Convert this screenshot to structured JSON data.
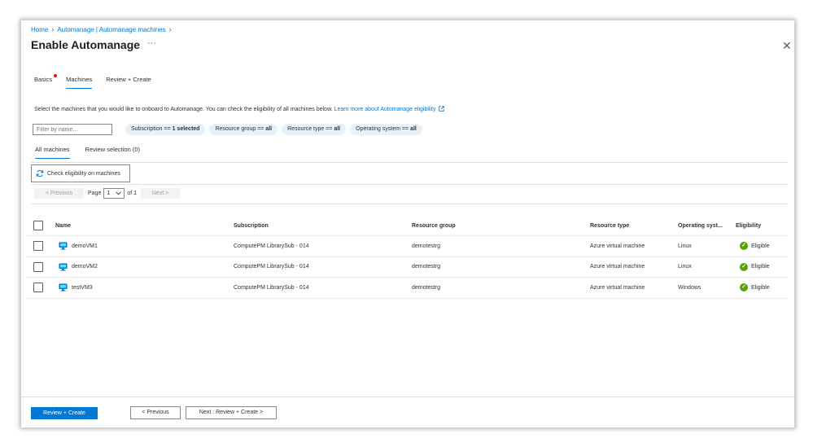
{
  "breadcrumb": [
    "Home",
    "Automanage | Automanage machines"
  ],
  "title": "Enable Automanage",
  "more_label": "···",
  "close_label": "✕",
  "wizard_tabs": [
    {
      "label": "Basics",
      "has_error": true
    },
    {
      "label": "Machines",
      "active": true
    },
    {
      "label": "Review + Create"
    }
  ],
  "description": "Select the machines that you would like to onboard to Automanage. You can check the eligibility of all machines below.",
  "learn_more_label": "Learn more about Automanage eligibility",
  "filter": {
    "placeholder": "Filter by name..."
  },
  "pills": [
    {
      "key": "Subscription == ",
      "value": "1 selected"
    },
    {
      "key": "Resource group == ",
      "value": "all"
    },
    {
      "key": "Resource type == ",
      "value": "all"
    },
    {
      "key": "Operating system == ",
      "value": "all"
    }
  ],
  "sub_tabs": [
    {
      "label": "All machines",
      "active": true
    },
    {
      "label": "Review selection (0)"
    }
  ],
  "check_eligibility_label": "Check eligibility on machines",
  "pager": {
    "prev_label": "< Previous",
    "page_label": "Page",
    "page_value": "1",
    "of_label": "of 1",
    "next_label": "Next >"
  },
  "table": {
    "columns": [
      "Name",
      "Subscription",
      "Resource group",
      "Resource type",
      "Operating syst...",
      "Eligibility"
    ],
    "rows": [
      {
        "name": "demoVM1",
        "subscription": "ComputePM LibrarySub - 014",
        "resource_group": "demotestrg",
        "resource_type": "Azure virtual machine",
        "os": "Linux",
        "eligibility": "Eligible"
      },
      {
        "name": "demoVM2",
        "subscription": "ComputePM LibrarySub - 014",
        "resource_group": "demotestrg",
        "resource_type": "Azure virtual machine",
        "os": "Linux",
        "eligibility": "Eligible"
      },
      {
        "name": "testVM3",
        "subscription": "ComputePM LibrarySub - 014",
        "resource_group": "demotestrg",
        "resource_type": "Azure virtual machine",
        "os": "Windows",
        "eligibility": "Eligible"
      }
    ]
  },
  "footer": {
    "review_create_label": "Review + Create",
    "previous_label": "< Previous",
    "next_label": "Next : Review + Create >"
  },
  "colors": {
    "accent": "#0078d4",
    "eligible": "#57a300",
    "error_dot": "#e81123"
  },
  "icons": {
    "vm": "virtual-machine-icon",
    "eligible": "check-circle-icon",
    "refresh": "refresh-icon",
    "external": "external-link-icon"
  }
}
